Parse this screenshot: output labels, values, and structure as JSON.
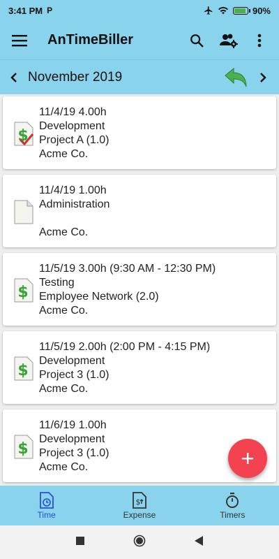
{
  "status_bar": {
    "time": "3:41 PM",
    "carrier_icon": "P",
    "battery": "90%",
    "battery_level": 0.9
  },
  "app_bar": {
    "title": "AnTimeBiller"
  },
  "month_bar": {
    "label": "November 2019"
  },
  "entries": [
    {
      "line1": "11/4/19 4.00h",
      "line2": "Development",
      "line3": "Project A (1.0)",
      "line4": "Acme Co.",
      "icon": "invoice-billed-icon"
    },
    {
      "line1": "11/4/19 1.00h",
      "line2": "Administration",
      "line3": "",
      "line4": "Acme Co.",
      "icon": "blank-document-icon"
    },
    {
      "line1": "11/5/19 3.00h (9:30 AM - 12:30 PM)",
      "line2": "Testing",
      "line3": "Employee Network (2.0)",
      "line4": "Acme Co.",
      "icon": "invoice-icon"
    },
    {
      "line1": "11/5/19 2.00h (2:00 PM - 4:15 PM)",
      "line2": "Development",
      "line3": "Project 3 (1.0)",
      "line4": "Acme Co.",
      "icon": "invoice-icon"
    },
    {
      "line1": "11/6/19 1.00h",
      "line2": "Development",
      "line3": "Project 3 (1.0)",
      "line4": "Acme Co.",
      "icon": "invoice-icon"
    }
  ],
  "bottom_nav": {
    "items": [
      {
        "label": "Time",
        "icon": "time-icon",
        "active": true
      },
      {
        "label": "Expense",
        "icon": "expense-icon",
        "active": false
      },
      {
        "label": "Timers",
        "icon": "stopwatch-icon",
        "active": false
      }
    ]
  },
  "colors": {
    "primary": "#89d3ec",
    "fab": "#f44350",
    "active_nav": "#2a4fd6",
    "undo_green": "#4caf50"
  }
}
